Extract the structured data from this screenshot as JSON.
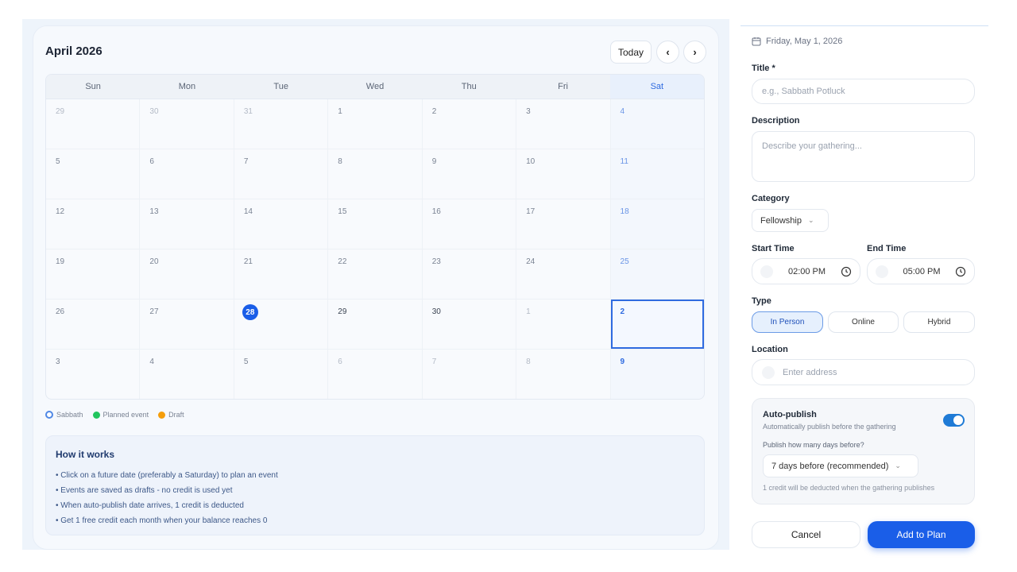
{
  "calendar": {
    "month_title": "April 2026",
    "today_label": "Today",
    "prev_icon": "chevron-left-icon",
    "next_icon": "chevron-right-icon",
    "weekdays": [
      "Sun",
      "Mon",
      "Tue",
      "Wed",
      "Thu",
      "Fri",
      "Sat"
    ],
    "weeks": [
      [
        "29",
        "30",
        "31",
        "1",
        "2",
        "3",
        "4"
      ],
      [
        "5",
        "6",
        "7",
        "8",
        "9",
        "10",
        "11"
      ],
      [
        "12",
        "13",
        "14",
        "15",
        "16",
        "17",
        "18"
      ],
      [
        "19",
        "20",
        "21",
        "22",
        "23",
        "24",
        "25"
      ],
      [
        "26",
        "27",
        "28",
        "29",
        "30",
        "1",
        "2"
      ],
      [
        "3",
        "4",
        "5",
        "6",
        "7",
        "8",
        "9"
      ]
    ],
    "today_date": "28",
    "selected_date": "2"
  },
  "legend": {
    "sabbath": "Sabbath",
    "planned": "Planned event",
    "draft": "Draft",
    "colors": {
      "sabbath": "#4f88e6",
      "planned": "#22c55e",
      "draft": "#f59e0b"
    }
  },
  "how": {
    "title": "How it works",
    "items": [
      "• Click on a future date (preferably a Saturday) to plan an event",
      "• Events are saved as drafts - no credit is used yet",
      "• When auto-publish date arrives, 1 credit is deducted",
      "• Get 1 free credit each month when your balance reaches 0"
    ]
  },
  "form": {
    "date_text": "Friday, May 1, 2026",
    "title_label": "Title *",
    "title_placeholder": "e.g., Sabbath Potluck",
    "description_label": "Description",
    "description_placeholder": "Describe your gathering...",
    "category_label": "Category",
    "category_value": "Fellowship",
    "start_label": "Start Time",
    "start_value": "02:00 PM",
    "end_label": "End Time",
    "end_value": "05:00 PM",
    "type_label": "Type",
    "types": [
      "In Person",
      "Online",
      "Hybrid"
    ],
    "location_label": "Location",
    "location_placeholder": "Enter address",
    "auto_title": "Auto-publish",
    "auto_sub": "Automatically publish before the gathering",
    "days_label": "Publish how many days before?",
    "days_value": "7 days before (recommended)",
    "credit_note": "1 credit will be deducted when the gathering publishes",
    "cancel": "Cancel",
    "add": "Add to Plan",
    "accent": "#1a5ee8"
  }
}
